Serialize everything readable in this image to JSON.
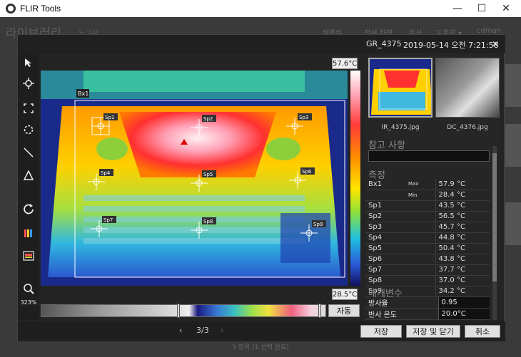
{
  "os_window": {
    "title": "FLIR Tools",
    "minimize": "—",
    "maximize": "☐",
    "close": "✕"
  },
  "background_app": {
    "title": "라이브러리",
    "subtitle": "노고서",
    "menu": [
      "템플릿",
      "전체 화면",
      "옵션",
      "도움말 ▾",
      "cdman"
    ],
    "status": "3 항목 (1 선택 완료)"
  },
  "dialog": {
    "file_name": "GR_4375",
    "datetime": "2019-05-14 오전 7:21:58",
    "close_label": "✕"
  },
  "toolbar": {
    "zoom_level": "323%"
  },
  "thermal_image": {
    "box_label": "Bx1",
    "spots": [
      "Sp1",
      "Sp2",
      "Sp3",
      "Sp4",
      "Sp5",
      "Sp6",
      "Sp7",
      "Sp8",
      "Sp9"
    ]
  },
  "scale": {
    "max": "57.6°C",
    "min": "28.5°C",
    "auto_label": "자동"
  },
  "thumbnails": [
    {
      "label": "IR_4375.jpg"
    },
    {
      "label": "DC_4376.jpg"
    }
  ],
  "side_panel": {
    "notes_title": "참고 사항",
    "measurements_title": "측정",
    "parameters_title": "매개변수",
    "measurements": [
      {
        "name": "Bx1",
        "sub": "Max",
        "value": "57.9 °C"
      },
      {
        "name": "",
        "sub": "Min",
        "value": "28.4 °C"
      },
      {
        "name": "Sp1",
        "sub": "",
        "value": "43.5 °C"
      },
      {
        "name": "Sp2",
        "sub": "",
        "value": "56.5 °C"
      },
      {
        "name": "Sp3",
        "sub": "",
        "value": "45.7 °C"
      },
      {
        "name": "Sp4",
        "sub": "",
        "value": "44.8 °C"
      },
      {
        "name": "Sp5",
        "sub": "",
        "value": "50.4 °C"
      },
      {
        "name": "Sp6",
        "sub": "",
        "value": "43.8 °C"
      },
      {
        "name": "Sp7",
        "sub": "",
        "value": "37.7 °C"
      },
      {
        "name": "Sp8",
        "sub": "",
        "value": "37.0 °C"
      },
      {
        "name": "Sp9",
        "sub": "",
        "value": "34.2 °C"
      }
    ],
    "parameters": [
      {
        "name": "방사율",
        "value": "0.95"
      },
      {
        "name": "반사 온도",
        "value": "20.0°C"
      }
    ]
  },
  "footer": {
    "prev": "‹",
    "page": "3/3",
    "next": "›",
    "save": "저장",
    "save_close": "저장 및 닫기",
    "cancel": "취소"
  },
  "colors": {
    "hot": "#ff2a2a",
    "warm": "#ffe600",
    "cool": "#2a5ad8"
  }
}
